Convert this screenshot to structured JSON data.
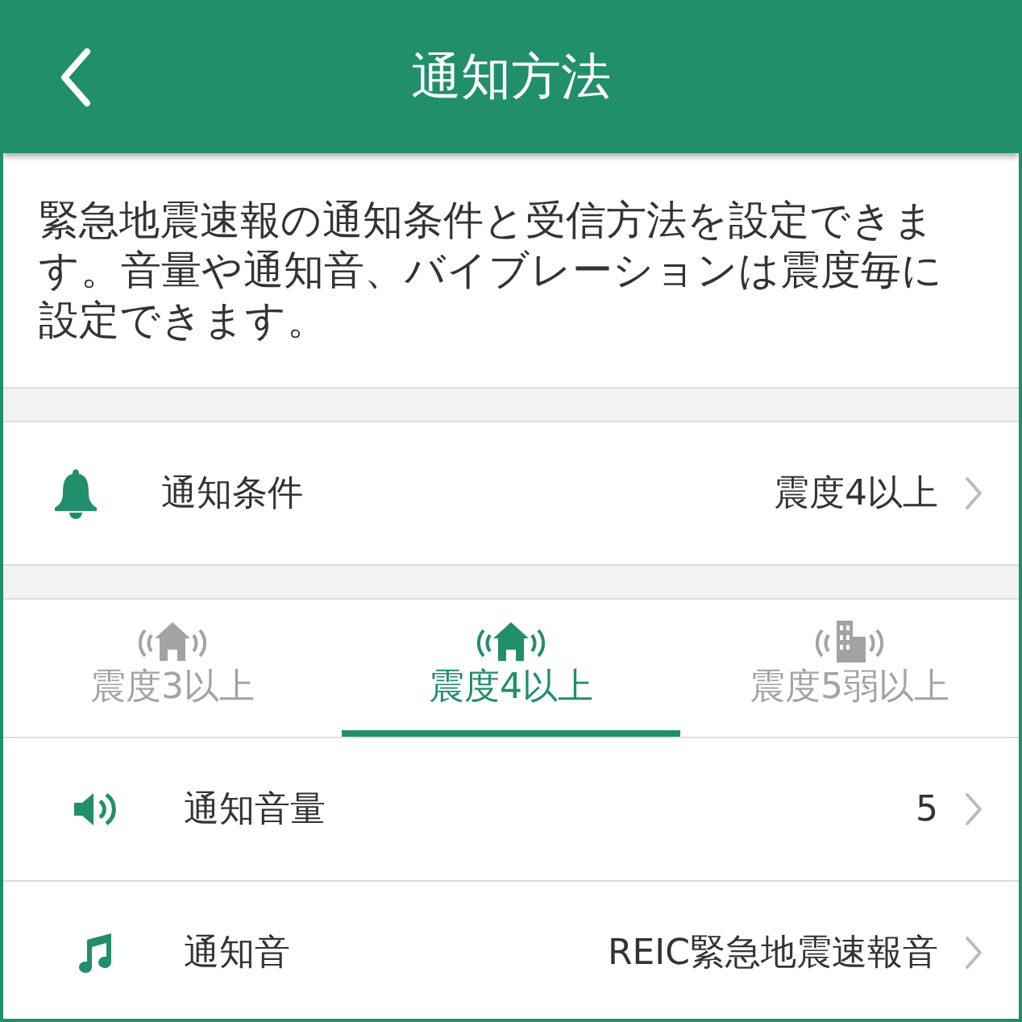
{
  "header": {
    "title": "通知方法"
  },
  "description": "緊急地震速報の通知条件と受信方法を設定できます。音量や通知音、バイブレーションは震度毎に設定できます。",
  "condition_row": {
    "label": "通知条件",
    "value": "震度4以上"
  },
  "tabs": [
    {
      "label": "震度3以上",
      "kind": "house",
      "selected": false
    },
    {
      "label": "震度4以上",
      "kind": "house",
      "selected": true
    },
    {
      "label": "震度5弱以上",
      "kind": "building",
      "selected": false
    }
  ],
  "settings": [
    {
      "kind": "volume",
      "label": "通知音量",
      "value": "5"
    },
    {
      "kind": "sound",
      "label": "通知音",
      "value": "REIC緊急地震速報音"
    }
  ]
}
